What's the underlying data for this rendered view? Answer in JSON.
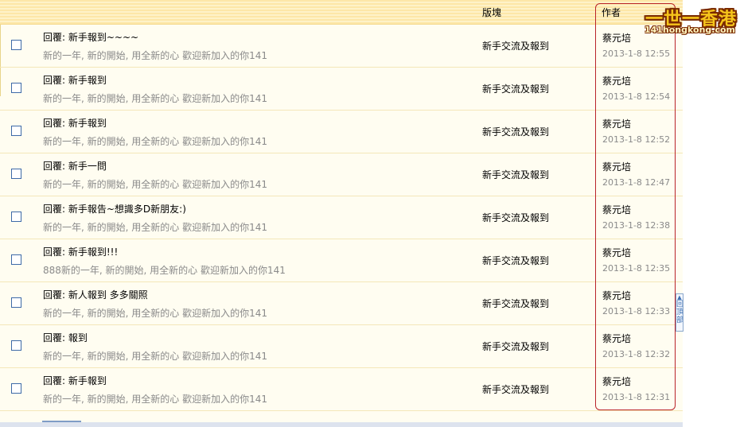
{
  "header": {
    "board_label": "版塊",
    "author_label": "作者"
  },
  "logo": {
    "chinese": "一世一香港",
    "domain": "141hongkong.com"
  },
  "back_to_top": {
    "label": "回頂部"
  },
  "rows": [
    {
      "title": "回覆:  新手報到~~~~",
      "summary": "新的一年, 新的開始, 用全新的心 歡迎新加入的你141",
      "board": "新手交流及報到",
      "author": "蔡元培",
      "time": "2013-1-8 12:55"
    },
    {
      "title": "回覆:  新手報到",
      "summary": "新的一年, 新的開始, 用全新的心 歡迎新加入的你141",
      "board": "新手交流及報到",
      "author": "蔡元培",
      "time": "2013-1-8 12:54"
    },
    {
      "title": "回覆:  新手報到",
      "summary": "新的一年, 新的開始, 用全新的心 歡迎新加入的你141",
      "board": "新手交流及報到",
      "author": "蔡元培",
      "time": "2013-1-8 12:52"
    },
    {
      "title": "回覆:  新手一問",
      "summary": "新的一年, 新的開始, 用全新的心 歡迎新加入的你141",
      "board": "新手交流及報到",
      "author": "蔡元培",
      "time": "2013-1-8 12:47"
    },
    {
      "title": "回覆:  新手報告~想識多D新朋友:)",
      "summary": "新的一年, 新的開始, 用全新的心 歡迎新加入的你141",
      "board": "新手交流及報到",
      "author": "蔡元培",
      "time": "2013-1-8 12:38"
    },
    {
      "title": "回覆:  新手報到!!!",
      "summary": "888新的一年, 新的開始, 用全新的心 歡迎新加入的你141",
      "board": "新手交流及報到",
      "author": "蔡元培",
      "time": "2013-1-8 12:35"
    },
    {
      "title": "回覆:  新人報到 多多關照",
      "summary": "新的一年, 新的開始, 用全新的心 歡迎新加入的你141",
      "board": "新手交流及報到",
      "author": "蔡元培",
      "time": "2013-1-8 12:33"
    },
    {
      "title": "回覆:  報到",
      "summary": "新的一年, 新的開始, 用全新的心 歡迎新加入的你141",
      "board": "新手交流及報到",
      "author": "蔡元培",
      "time": "2013-1-8 12:32"
    },
    {
      "title": "回覆:  新手報到",
      "summary": "新的一年, 新的開始, 用全新的心 歡迎新加入的你141",
      "board": "新手交流及報到",
      "author": "蔡元培",
      "time": "2013-1-8 12:31"
    }
  ]
}
